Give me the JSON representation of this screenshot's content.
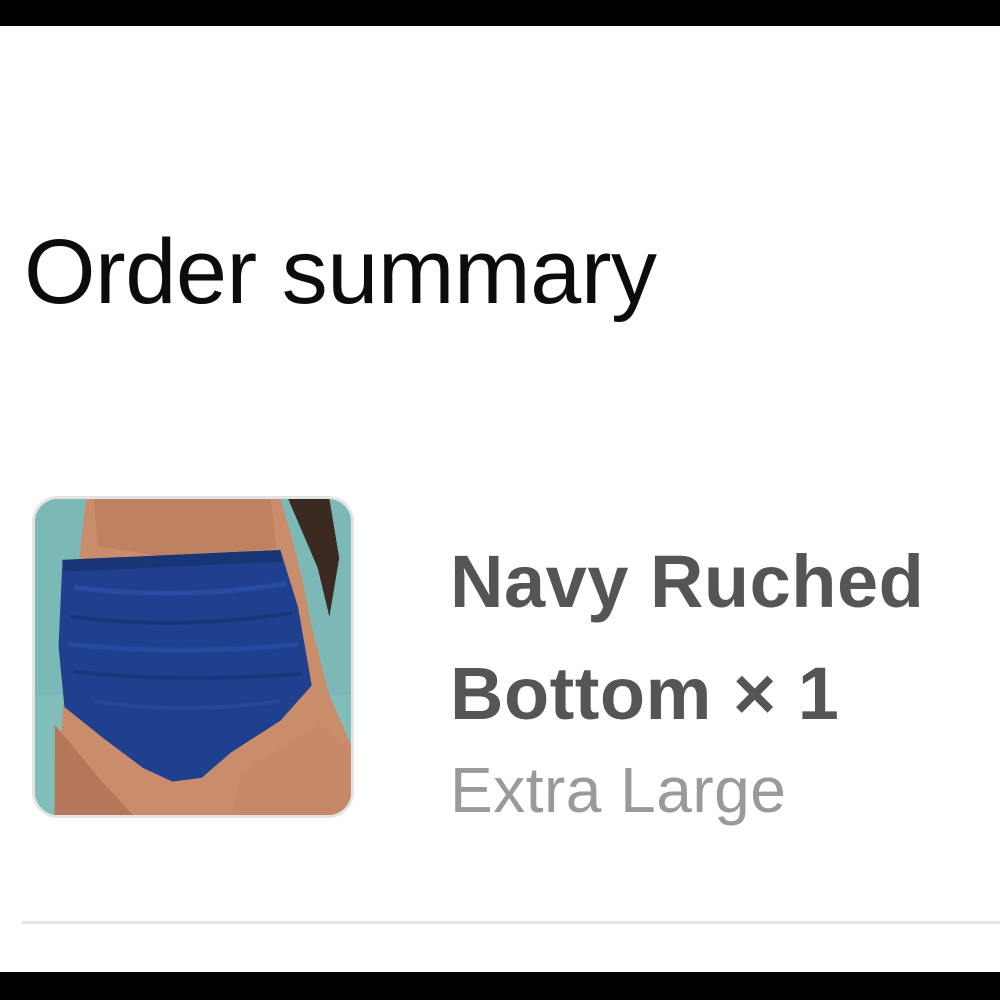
{
  "order_summary": {
    "title": "Order summary",
    "items": [
      {
        "name_line1": "Navy Ruched",
        "name_line2": "Bottom",
        "quantity_text": "× 1",
        "variant": "Extra Large",
        "image_alt": "Navy ruched high-waisted swim bottom"
      }
    ]
  },
  "colors": {
    "title_text": "#0c0c0c",
    "item_name_text": "#555555",
    "variant_text": "#9a9a9a",
    "divider": "#e4e4e4",
    "product_navy": "#1f3f8f"
  }
}
